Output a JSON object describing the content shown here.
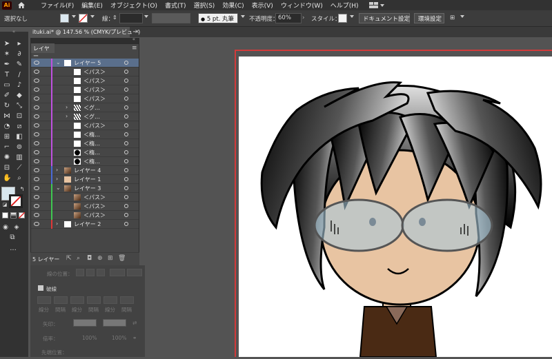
{
  "menubar": {
    "logo": "Ai",
    "items": [
      "ファイル(F)",
      "編集(E)",
      "オブジェクト(O)",
      "書式(T)",
      "選択(S)",
      "効果(C)",
      "表示(V)",
      "ウィンドウ(W)",
      "ヘルプ(H)"
    ]
  },
  "control": {
    "selection": "選択なし",
    "stroke_label": "線：",
    "brush": "5 pt. 丸筆",
    "opacity_label": "不透明度：",
    "opacity": "60%",
    "style_label": "スタイル：",
    "doc_settings": "ドキュメント設定",
    "prefs": "環境設定"
  },
  "document_tab": {
    "title": "ituki.ai* @ 147.56 % (CMYK/プレビュー)",
    "close": "×"
  },
  "layers_panel": {
    "tab": "レイヤー",
    "rows": [
      {
        "name": "レイヤー 5",
        "color": "#c050e0",
        "indent": 0,
        "expand": "open",
        "thumb": "white",
        "selected": true
      },
      {
        "name": "＜パス＞",
        "color": "#c050e0",
        "indent": 1,
        "thumb": "white"
      },
      {
        "name": "＜パス＞",
        "color": "#c050e0",
        "indent": 1,
        "thumb": "white"
      },
      {
        "name": "＜パス＞",
        "color": "#c050e0",
        "indent": 1,
        "thumb": "white"
      },
      {
        "name": "＜パス＞",
        "color": "#c050e0",
        "indent": 1,
        "thumb": "white"
      },
      {
        "name": "＜グ…",
        "color": "#c050e0",
        "indent": 1,
        "expand": "closed",
        "thumb": "hair"
      },
      {
        "name": "＜グ…",
        "color": "#c050e0",
        "indent": 1,
        "expand": "closed",
        "thumb": "hair"
      },
      {
        "name": "＜パス＞",
        "color": "#c050e0",
        "indent": 1,
        "thumb": "white"
      },
      {
        "name": "＜楕…",
        "color": "#c050e0",
        "indent": 1,
        "thumb": "white"
      },
      {
        "name": "＜楕…",
        "color": "#c050e0",
        "indent": 1,
        "thumb": "white"
      },
      {
        "name": "＜楕…",
        "color": "#c050e0",
        "indent": 1,
        "thumb": "dot"
      },
      {
        "name": "＜楕…",
        "color": "#c050e0",
        "indent": 1,
        "thumb": "dot"
      },
      {
        "name": "レイヤー 4",
        "color": "#4a6ad8",
        "indent": 0,
        "expand": "closed",
        "thumb": "face"
      },
      {
        "name": "レイヤー 1",
        "color": "#4a6ad8",
        "indent": 0,
        "expand": "closed",
        "thumb": "skin"
      },
      {
        "name": "レイヤー 3",
        "color": "#3fc850",
        "indent": 0,
        "expand": "open",
        "thumb": "face"
      },
      {
        "name": "＜パス＞",
        "color": "#3fc850",
        "indent": 1,
        "thumb": "face"
      },
      {
        "name": "＜パス＞",
        "color": "#3fc850",
        "indent": 1,
        "thumb": "face"
      },
      {
        "name": "＜パス＞",
        "color": "#3fc850",
        "indent": 1,
        "thumb": "face"
      },
      {
        "name": "レイヤー 2",
        "color": "#e03838",
        "indent": 0,
        "expand": "closed",
        "thumb": "white"
      }
    ],
    "footer_count": "5 レイヤー"
  },
  "properties": {
    "line_position": "線の位置：",
    "dashed": "破線",
    "dash_labels": [
      "線分",
      "間隔",
      "線分",
      "間隔",
      "線分",
      "間隔"
    ],
    "arrow_label": "矢印：",
    "scale_label": "倍率：",
    "scale_a": "100%",
    "scale_b": "100%",
    "tip_label": "先端位置："
  },
  "colors": {
    "accent_selected": "#5a6f8c",
    "artboard_border": "#d23a3a",
    "skin": "#e8c4a2",
    "shirt": "#4a2a14",
    "glasses": "#a8c8d8"
  }
}
